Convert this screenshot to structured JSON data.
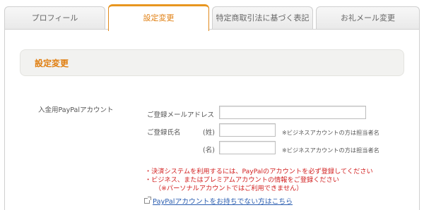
{
  "tabs": [
    {
      "label": "プロフィール",
      "active": false
    },
    {
      "label": "設定変更",
      "active": true
    },
    {
      "label": "特定商取引法に基づく表記",
      "active": false
    },
    {
      "label": "お礼メール変更",
      "active": false
    }
  ],
  "section": {
    "title": "設定変更"
  },
  "paypal_account": {
    "label": "入金用PayPalアカウント",
    "email_label": "ご登録メールアドレス",
    "email_value": "",
    "name_label": "ご登録氏名",
    "last_name_label": "(姓)",
    "last_name_value": "",
    "first_name_label": "(名)",
    "first_name_value": "",
    "business_note": "※ビジネスアカウントの方は担当者名"
  },
  "warnings": [
    "・決済システムを利用するには、PayPalのアカウントを必ず登録してください",
    "・ビジネス、またはプレミアムアカウントの情報をご登録ください",
    "（※パーソナルアカウントではご利用できません）"
  ],
  "link": {
    "text": "PayPalアカウントをお持ちでない方はこちら"
  },
  "colors": {
    "accent": "#e07f11",
    "warning": "#d21f1f",
    "link": "#2a5db0"
  }
}
